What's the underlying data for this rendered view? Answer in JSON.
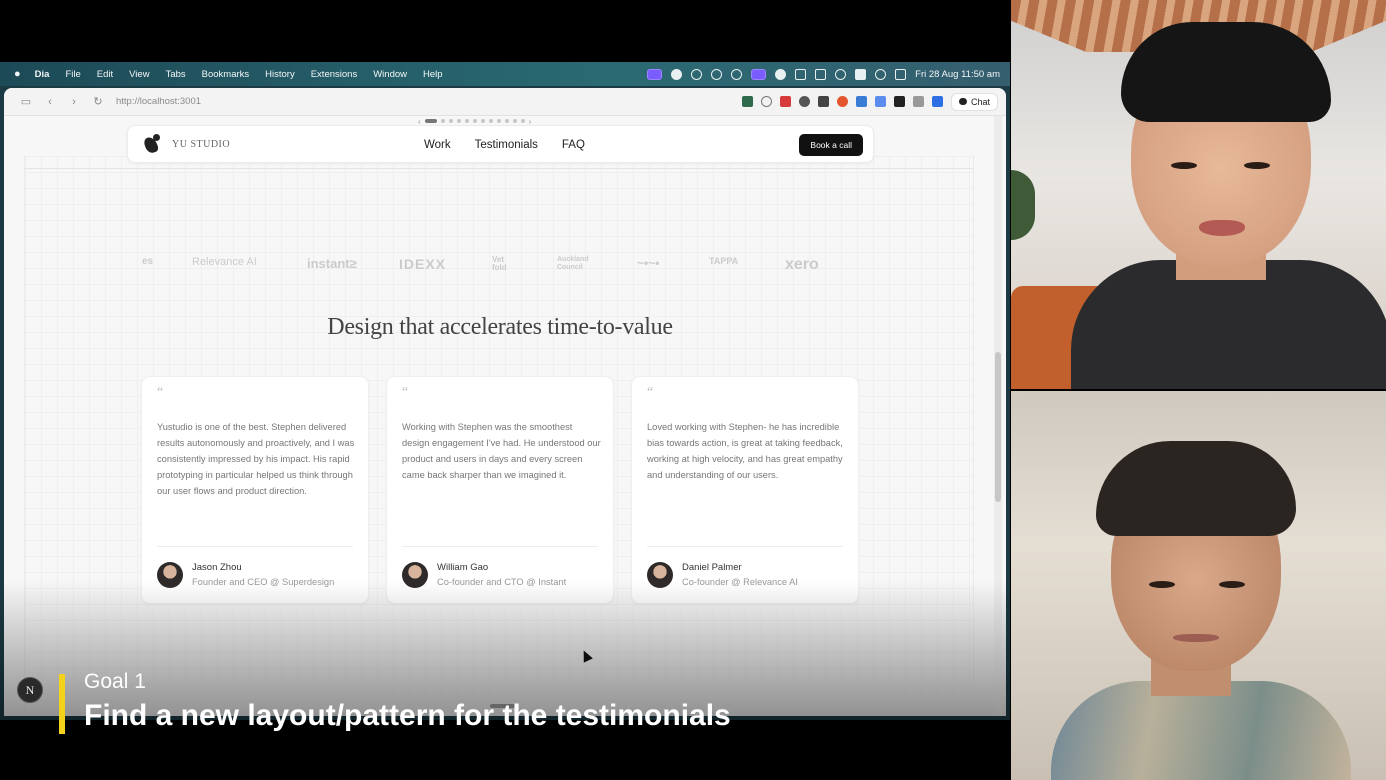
{
  "menubar": {
    "app": "Dia",
    "items": [
      "File",
      "Edit",
      "View",
      "Tabs",
      "Bookmarks",
      "History",
      "Extensions",
      "Window",
      "Help"
    ],
    "clock": "Fri 28 Aug  11:50 am"
  },
  "browser": {
    "url": "http://localhost:3001",
    "chat_label": "Chat"
  },
  "site": {
    "brand": "YU STUDIO",
    "nav": [
      "Work",
      "Testimonials",
      "FAQ"
    ],
    "cta": "Book a call",
    "client_logos": [
      "es",
      "Relevance AI",
      "instant≥",
      "IDEXX",
      "Vet fold",
      "Auckland Council",
      "~•~•",
      "TAPPA",
      "xero"
    ],
    "section_title": "Design that accelerates time-to-value",
    "testimonials": [
      {
        "quote": "Yustudio is one of the best. Stephen delivered results autonomously and proactively, and I was consistently impressed by his impact. His rapid prototyping in particular helped us think through our user flows and product direction.",
        "name": "Jason Zhou",
        "role": "Founder and CEO @ Superdesign"
      },
      {
        "quote": "Working with Stephen was the smoothest design engagement I've had. He understood our product and users in days and every screen came back sharper than we imagined it.",
        "name": "William Gao",
        "role": "Co-founder and CTO @ Instant"
      },
      {
        "quote": "Loved working with Stephen- he has incredible bias towards action, is great at taking feedback, working at high velocity, and has great empathy and understanding of our users.",
        "name": "Daniel Palmer",
        "role": "Co-founder @ Relevance AI"
      }
    ]
  },
  "overlay": {
    "badge": "N",
    "goal_label": "Goal 1",
    "goal_title": "Find a new layout/pattern for the testimonials"
  },
  "colors": {
    "accent_bar": "#f3d21c",
    "cta_bg": "#111111"
  }
}
